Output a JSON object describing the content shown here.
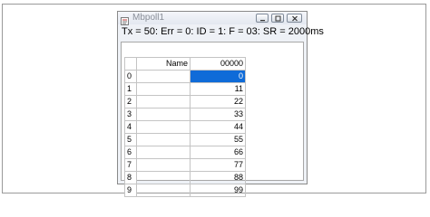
{
  "window": {
    "title": "Mbpoll1",
    "status_line": "Tx = 50: Err = 0: ID = 1: F = 03: SR = 2000ms"
  },
  "table": {
    "headers": {
      "index": "",
      "name": "Name",
      "value": "00000"
    },
    "rows": [
      {
        "index": "0",
        "name": "",
        "value": "0",
        "selected": true
      },
      {
        "index": "1",
        "name": "",
        "value": "11"
      },
      {
        "index": "2",
        "name": "",
        "value": "22"
      },
      {
        "index": "3",
        "name": "",
        "value": "33"
      },
      {
        "index": "4",
        "name": "",
        "value": "44"
      },
      {
        "index": "5",
        "name": "",
        "value": "55"
      },
      {
        "index": "6",
        "name": "",
        "value": "66"
      },
      {
        "index": "7",
        "name": "",
        "value": "77"
      },
      {
        "index": "8",
        "name": "",
        "value": "88"
      },
      {
        "index": "9",
        "name": "",
        "value": "99"
      }
    ]
  },
  "colors": {
    "selection": "#0f6bd8",
    "window_bg": "#eef1f6",
    "title_text": "#8a8f99"
  }
}
